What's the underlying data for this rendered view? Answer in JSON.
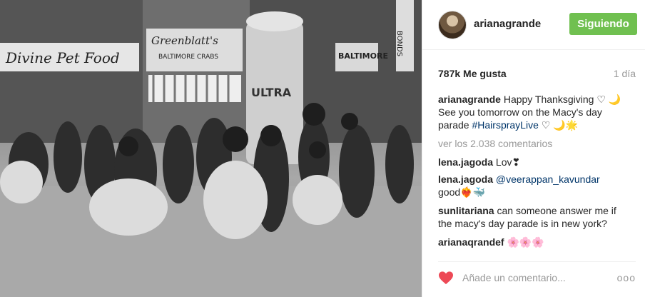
{
  "post": {
    "username": "arianagrande",
    "follow_label": "Siguiendo",
    "likes": "787k Me gusta",
    "time": "1 día",
    "caption_user": "arianagrande",
    "caption_text": "Happy Thanksgiving ♡ 🌙 See you tomorrow on the Macy's day parade ",
    "caption_hashtag": "#HairsprayLive",
    "caption_end": " ♡ 🌙🌟",
    "view_all": "ver los 2.038 comentarios",
    "comments": [
      {
        "user": "lena.jagoda",
        "text": " Lov❣"
      },
      {
        "user": "lena.jagoda",
        "mention": "@veerappan_kavundar",
        "text": "good❤️‍🔥🐳"
      },
      {
        "user": "sunlitariana",
        "text": " can someone answer me if the macy's day parade is in new york?"
      },
      {
        "user": "arianaqrandef",
        "text": " 🌸🌸🌸"
      }
    ],
    "add_comment_placeholder": "Añade un comentario...",
    "more_label": "ooo"
  },
  "photo": {
    "signs": [
      "Divine Pet Food",
      "Greenblatt's",
      "BALTIMORE CRABS",
      "BALTIMORE",
      "ULTRA",
      "BONDS"
    ]
  },
  "colors": {
    "follow_green": "#70c050",
    "link_blue": "#003569",
    "heart_red": "#ed4956"
  }
}
